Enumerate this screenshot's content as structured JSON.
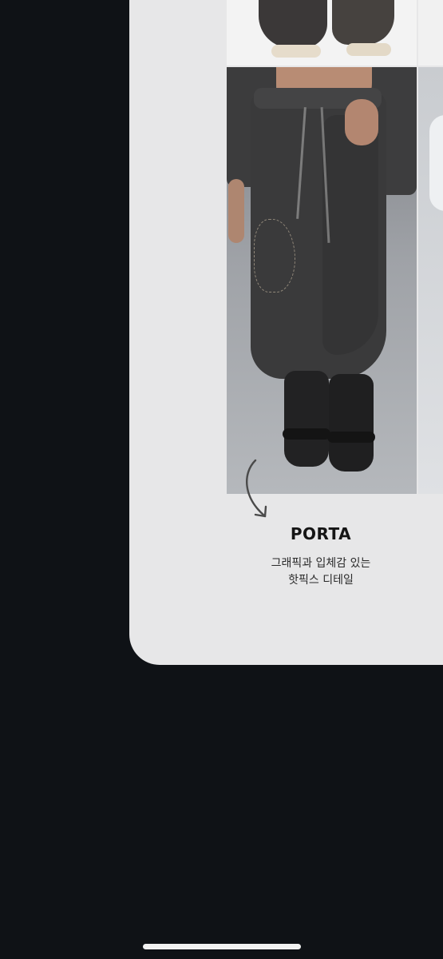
{
  "product": {
    "title": "PORTA",
    "description_line1": "그래픽과 입체감 있는",
    "description_line2": "핫픽스 디테일"
  },
  "images": {
    "top_photo": "photo-sneakers-feet",
    "main_photo": "photo-model-charcoal-sweatpants",
    "next_photo": "photo-next-item-partial"
  },
  "icons": {
    "arrow": "curved-arrow-icon"
  },
  "colors": {
    "background": "#0f1216",
    "card": "#e7e7e8",
    "text": "#151515",
    "home_indicator": "#f2f2f2"
  }
}
